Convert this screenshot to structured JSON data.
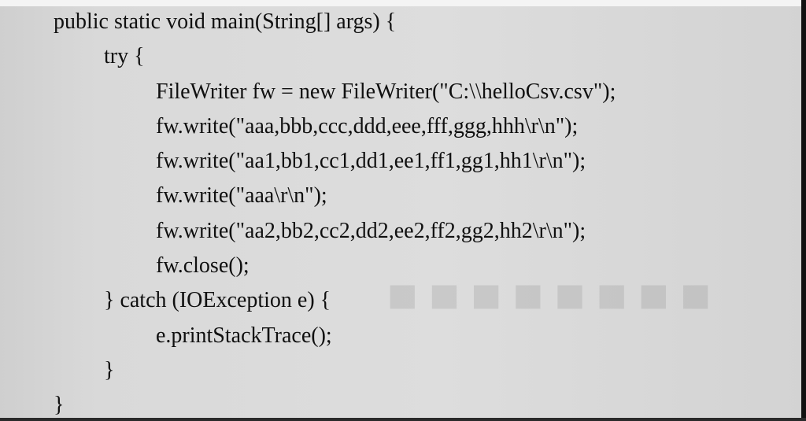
{
  "code": {
    "lines": [
      {
        "text": "public static void main(String[] args) {"
      },
      {
        "text": "try {"
      },
      {
        "text": "FileWriter fw = new FileWriter(\"C:\\\\helloCsv.csv\");"
      },
      {
        "text": "fw.write(\"aaa,bbb,ccc,ddd,eee,fff,ggg,hhh\\r\\n\");"
      },
      {
        "text": "fw.write(\"aa1,bb1,cc1,dd1,ee1,ff1,gg1,hh1\\r\\n\");"
      },
      {
        "text": "fw.write(\"aaa\\r\\n\");"
      },
      {
        "text": "fw.write(\"aa2,bb2,cc2,dd2,ee2,ff2,gg2,hh2\\r\\n\");"
      },
      {
        "text": "fw.close();"
      },
      {
        "text": "} catch (IOException e) {"
      },
      {
        "text": "e.printStackTrace();"
      },
      {
        "text": "}"
      },
      {
        "text": "}"
      }
    ]
  }
}
